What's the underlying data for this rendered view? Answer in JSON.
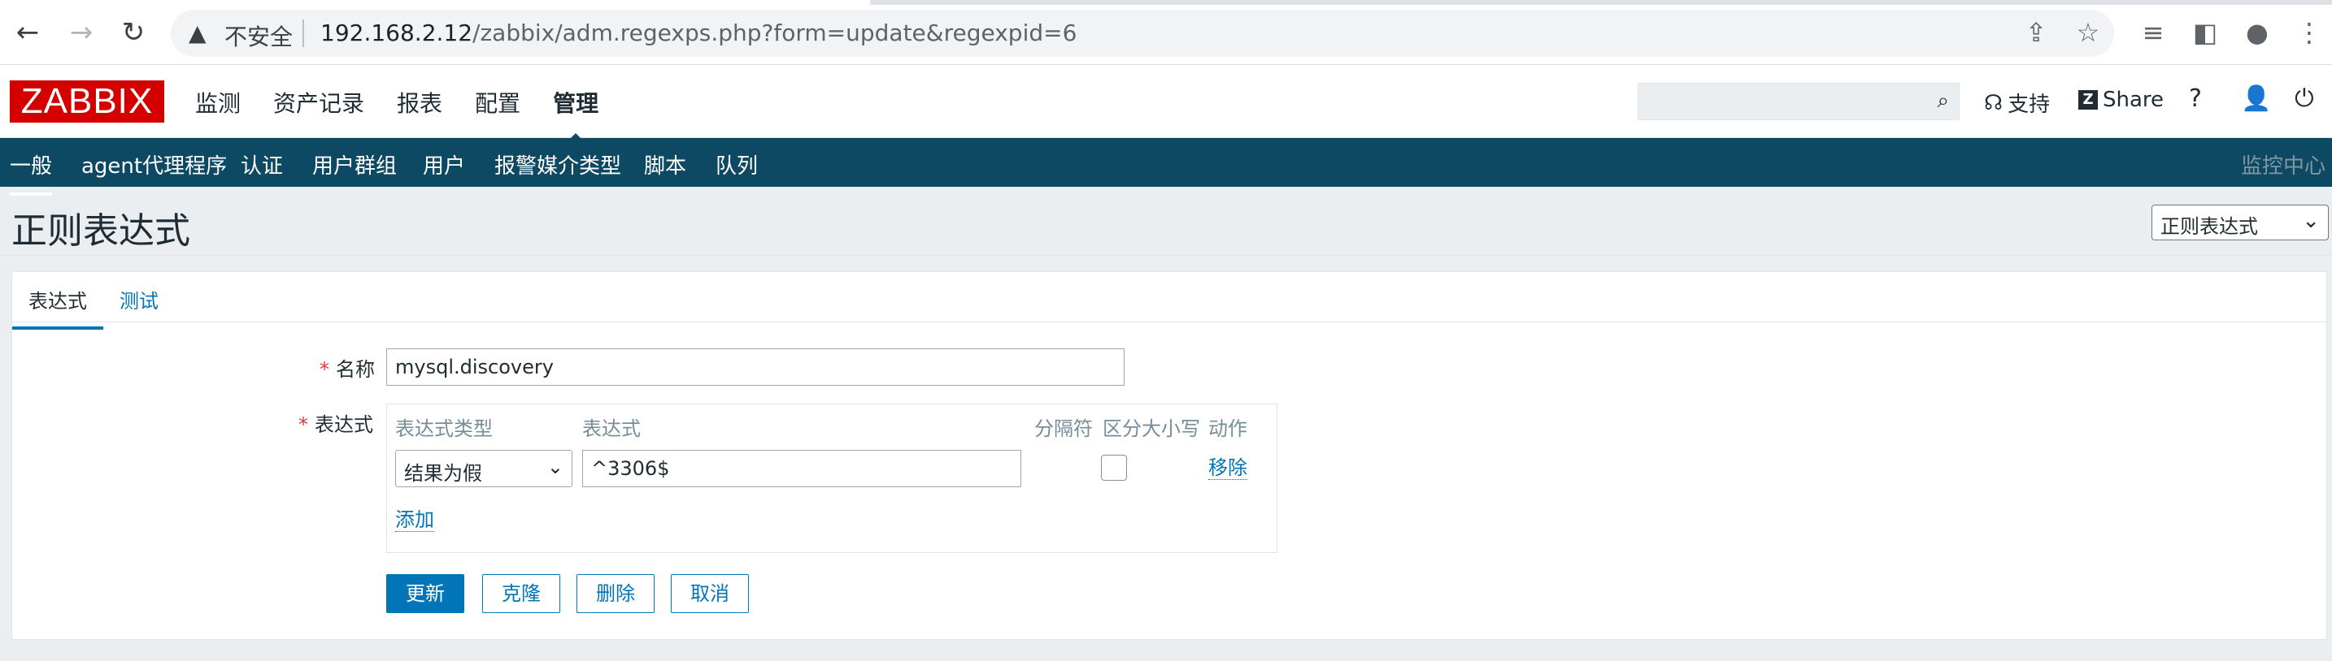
{
  "browser": {
    "security_label": "不安全",
    "url_host": "192.168.2.12",
    "url_path": "/zabbix/adm.regexps.php?form=update&regexpid=6"
  },
  "header": {
    "logo": "ZABBIX",
    "menu": [
      "监测",
      "资产记录",
      "报表",
      "配置",
      "管理"
    ],
    "support": "支持",
    "share": "Share",
    "help": "?"
  },
  "subnav": {
    "items": [
      "一般",
      "agent代理程序",
      "认证",
      "用户群组",
      "用户",
      "报警媒介类型",
      "脚本",
      "队列"
    ],
    "right": "监控中心"
  },
  "page": {
    "title": "正则表达式",
    "view_select": "正则表达式"
  },
  "tabs": [
    "表达式",
    "测试"
  ],
  "form": {
    "name_label": "名称",
    "name_value": "mysql.discovery",
    "expr_label": "表达式",
    "columns": {
      "type": "表达式类型",
      "expression": "表达式",
      "delimiter": "分隔符",
      "case": "区分大小写",
      "action": "动作"
    },
    "row": {
      "type": "结果为假",
      "expression": "^3306$",
      "case_sensitive": false,
      "action": "移除"
    },
    "add_link": "添加"
  },
  "buttons": {
    "update": "更新",
    "clone": "克隆",
    "delete": "删除",
    "cancel": "取消"
  }
}
